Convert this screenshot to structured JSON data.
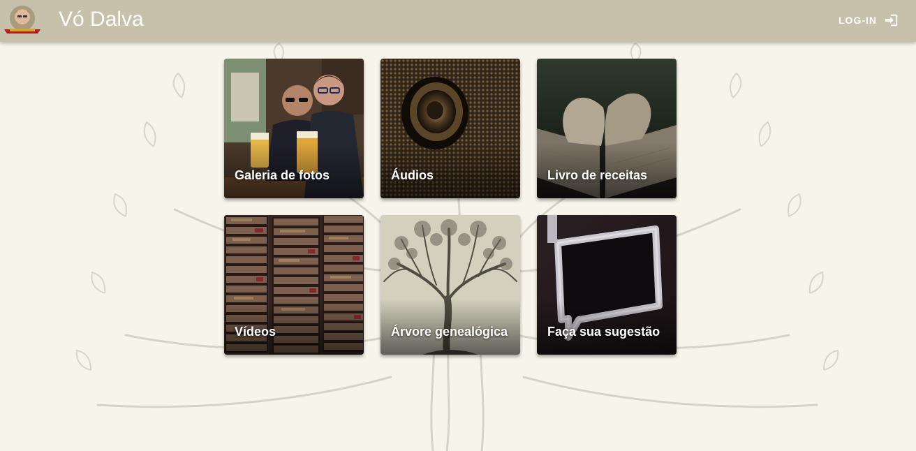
{
  "header": {
    "title": "Vó Dalva",
    "login_label": "LOG-IN",
    "login_icon": "login-icon",
    "background_color": "#c7c1ab"
  },
  "page": {
    "background_color": "#f7f5ea"
  },
  "cards": [
    {
      "label": "Galeria de fotos",
      "icon": "photo-gallery-image"
    },
    {
      "label": "Áudios",
      "icon": "speaker-image"
    },
    {
      "label": "Livro de receitas",
      "icon": "book-heart-image"
    },
    {
      "label": "Vídeos",
      "icon": "vhs-tapes-image"
    },
    {
      "label": "Árvore genealógica",
      "icon": "tree-image"
    },
    {
      "label": "Faça sua sugestão",
      "icon": "neon-speech-bubble-image"
    }
  ]
}
